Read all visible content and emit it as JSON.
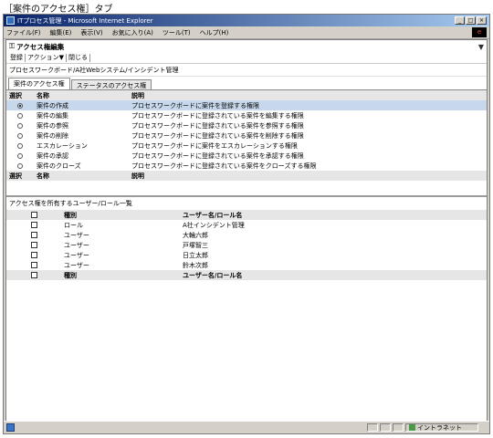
{
  "caption": "［案件のアクセス権］タブ",
  "window": {
    "title": "ITプロセス管理 - Microsoft Internet Explorer",
    "min": "_",
    "max": "□",
    "close": "×"
  },
  "menu": [
    "ファイル(F)",
    "編集(E)",
    "表示(V)",
    "お気に入り(A)",
    "ツール(T)",
    "ヘルプ(H)"
  ],
  "ie_logo": "e",
  "page": {
    "title": "アクセス権編集",
    "toolbar": [
      "登録",
      "アクション▼",
      "閉じる"
    ],
    "breadcrumb": "プロセスワークボード/A社Webシステム/インシデント管理",
    "tabs": [
      "案件のアクセス権",
      "ステータスのアクセス権"
    ]
  },
  "perm_table": {
    "headers": [
      "選択",
      "名称",
      "説明"
    ],
    "rows": [
      {
        "selected": true,
        "name": "案件の作成",
        "desc": "プロセスワークボードに案件を登録する権限"
      },
      {
        "selected": false,
        "name": "案件の編集",
        "desc": "プロセスワークボードに登録されている案件を編集する権限"
      },
      {
        "selected": false,
        "name": "案件の参照",
        "desc": "プロセスワークボードに登録されている案件を参照する権限"
      },
      {
        "selected": false,
        "name": "案件の削除",
        "desc": "プロセスワークボードに登録されている案件を削除する権限"
      },
      {
        "selected": false,
        "name": "エスカレーション",
        "desc": "プロセスワークボードに案件をエスカレーションする権限"
      },
      {
        "selected": false,
        "name": "案件の承認",
        "desc": "プロセスワークボードに登録されている案件を承認する権限"
      },
      {
        "selected": false,
        "name": "案件のクローズ",
        "desc": "プロセスワークボードに登録されている案件をクローズする権限"
      }
    ],
    "footer": [
      "選択",
      "名称",
      "説明"
    ]
  },
  "user_list": {
    "title": "アクセス権を所有するユーザー/ロール一覧",
    "headers": [
      "種別",
      "ユーザー名/ロール名"
    ],
    "rows": [
      {
        "type": "ロール",
        "name": "A社インシデント管理"
      },
      {
        "type": "ユーザー",
        "name": "大輪六郎"
      },
      {
        "type": "ユーザー",
        "name": "戸塚智三"
      },
      {
        "type": "ユーザー",
        "name": "日立太郎"
      },
      {
        "type": "ユーザー",
        "name": "鈴木次郎"
      }
    ],
    "footer": [
      "種別",
      "ユーザー名/ロール名"
    ]
  },
  "status": {
    "zone": "イントラネット"
  }
}
